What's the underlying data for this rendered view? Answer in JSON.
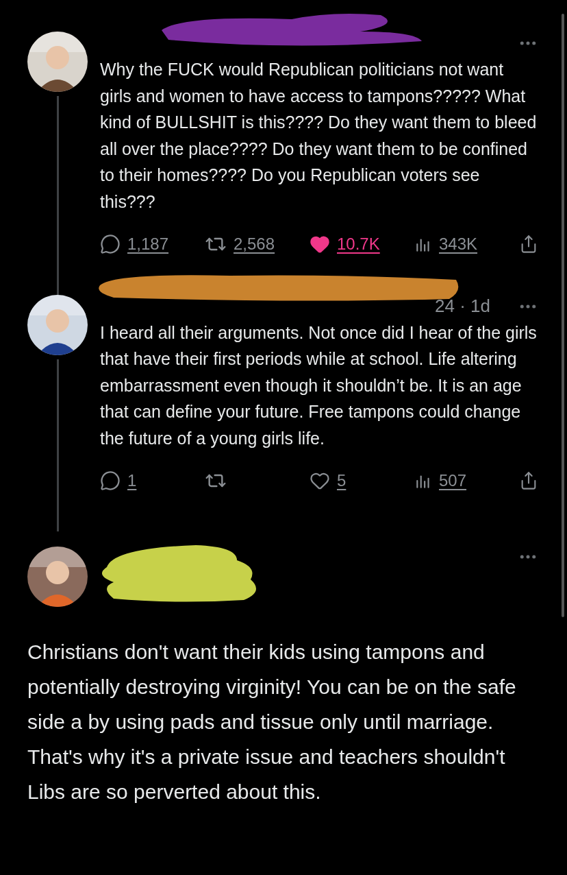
{
  "posts": [
    {
      "kind": "thread",
      "text": "Why the FUCK would Republican politicians not want girls and women to have access to tampons?????  What kind of BULLSHIT is this????  Do they want them to bleed all over the place????  Do they want them to be confined to their homes????  Do you Republican voters see this???",
      "actions": [
        {
          "kind": "reply",
          "count": "1,187"
        },
        {
          "kind": "repost",
          "count": "2,568"
        },
        {
          "kind": "like",
          "count": "10.7K",
          "liked": true
        },
        {
          "kind": "views",
          "count": "343K"
        },
        {
          "kind": "share"
        }
      ]
    },
    {
      "kind": "thread",
      "meta": "24 · 1d",
      "text": "I heard all their arguments. Not once did I hear of the girls that have their first periods while at school. Life altering embarrassment even though it shouldn’t be. It is an age that can define your future. Free tampons could change the future of a young girls life.",
      "actions": [
        {
          "kind": "reply",
          "count": "1"
        },
        {
          "kind": "repost"
        },
        {
          "kind": "like",
          "count": "5",
          "liked": false
        },
        {
          "kind": "views",
          "count": "507"
        },
        {
          "kind": "share"
        }
      ]
    },
    {
      "kind": "main",
      "text": "Christians don't want their kids using tampons and potentially destroying virginity! You can be on the safe side a by using pads and tissue only until marriage. That's why it's a private issue and teachers shouldn't Libs are so perverted about this."
    }
  ]
}
